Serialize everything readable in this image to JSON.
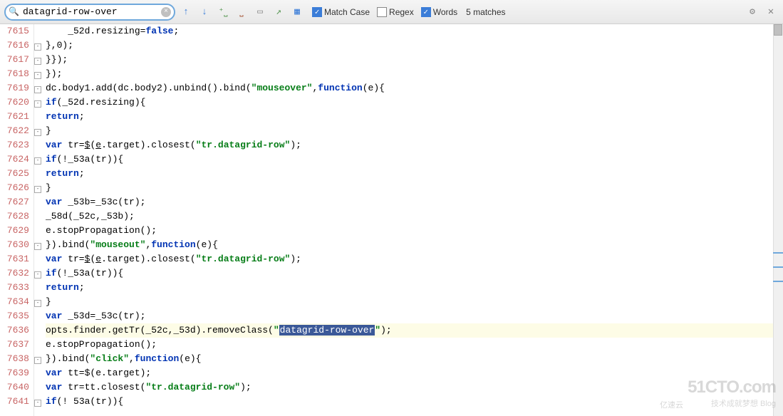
{
  "toolbar": {
    "search_value": "datagrid-row-over",
    "search_placeholder": "",
    "match_case_label": "Match Case",
    "match_case_checked": true,
    "regex_label": "Regex",
    "regex_checked": false,
    "words_label": "Words",
    "words_checked": true,
    "match_count": "5 matches"
  },
  "gutter": {
    "lines": [
      "7615",
      "7616",
      "7617",
      "7618",
      "7619",
      "7620",
      "7621",
      "7622",
      "7623",
      "7624",
      "7625",
      "7626",
      "7627",
      "7628",
      "7629",
      "7630",
      "7631",
      "7632",
      "7633",
      "7634",
      "7635",
      "7636",
      "7637",
      "7638",
      "7639",
      "7640",
      "7641"
    ]
  },
  "code": {
    "l0_a": "    _52d.resizing=",
    "l0_kw": "false",
    "l0_b": ";",
    "l1": "},0);",
    "l2": "}});",
    "l3": "});",
    "l4_a": "dc.body1.add(dc.body2).unbind().bind(",
    "l4_s1": "\"mouseover\"",
    "l4_b": ",",
    "l4_kw": "function",
    "l4_c": "(e){",
    "l5_kw": "if",
    "l5_a": "(_52d.resizing){",
    "l6_kw": "return",
    "l6_a": ";",
    "l7": "}",
    "l8_kw": "var",
    "l8_a": " tr=",
    "l8_u": "$",
    "l8_b": "(",
    "l8_u2": "e",
    "l8_c": ".target).closest(",
    "l8_s": "\"tr.datagrid-row\"",
    "l8_d": ");",
    "l9_kw": "if",
    "l9_a": "(!_53a(tr)){",
    "l10_kw": "return",
    "l10_a": ";",
    "l11": "}",
    "l12_kw": "var",
    "l12_a": " _53b=_53c(tr);",
    "l13": "_58d(_52c,_53b);",
    "l14": "e.stopPropagation();",
    "l15_a": "}).bind(",
    "l15_s": "\"mouseout\"",
    "l15_b": ",",
    "l15_kw": "function",
    "l15_c": "(e){",
    "l16_kw": "var",
    "l16_a": " tr=",
    "l16_u": "$",
    "l16_b": "(",
    "l16_u2": "e",
    "l16_c": ".target).closest(",
    "l16_s": "\"tr.datagrid-row\"",
    "l16_d": ");",
    "l17_kw": "if",
    "l17_a": "(!_53a(tr)){",
    "l18_kw": "return",
    "l18_a": ";",
    "l19": "}",
    "l20_kw": "var",
    "l20_a": " _53d=_53c(tr);",
    "l21_a": "opts.finder.getTr(_52c,_53d).removeClass(",
    "l21_q1": "\"",
    "l21_hl": "datagrid-row-over",
    "l21_q2": "\"",
    "l21_b": ");",
    "l22": "e.stopPropagation();",
    "l23_a": "}).bind(",
    "l23_s": "\"click\"",
    "l23_b": ",",
    "l23_kw": "function",
    "l23_c": "(e){",
    "l24_kw": "var",
    "l24_a": " tt=$(e.target);",
    "l25_kw": "var",
    "l25_a": " tr=tt.closest(",
    "l25_s": "\"tr.datagrid-row\"",
    "l25_b": ");",
    "l26_kw": "if",
    "l26_a": "(! 53a(tr)){"
  },
  "highlight_line_index": 21,
  "watermark": {
    "big": "51CTO.com",
    "small": "技术成就梦想 Blog",
    "other": "亿速云"
  }
}
